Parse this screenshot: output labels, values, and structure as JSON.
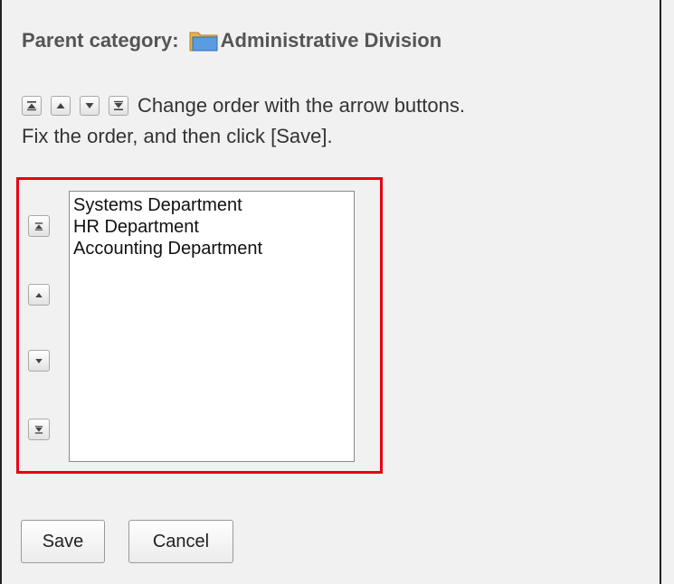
{
  "parent": {
    "label": "Parent category:",
    "name": "Administrative Division",
    "icon": "folder-icon"
  },
  "instructions": {
    "line1": "Change order with the arrow buttons.",
    "line2": "Fix the order, and then click [Save]."
  },
  "order_buttons": {
    "top_icon": "move-to-top-icon",
    "up_icon": "move-up-icon",
    "down_icon": "move-down-icon",
    "bottom_icon": "move-to-bottom-icon"
  },
  "list": {
    "items": [
      "Systems Department",
      "HR Department",
      "Accounting Department"
    ]
  },
  "actions": {
    "save_label": "Save",
    "cancel_label": "Cancel"
  },
  "colors": {
    "highlight_border": "#e60012",
    "folder_blue": "#4d8fd6"
  }
}
